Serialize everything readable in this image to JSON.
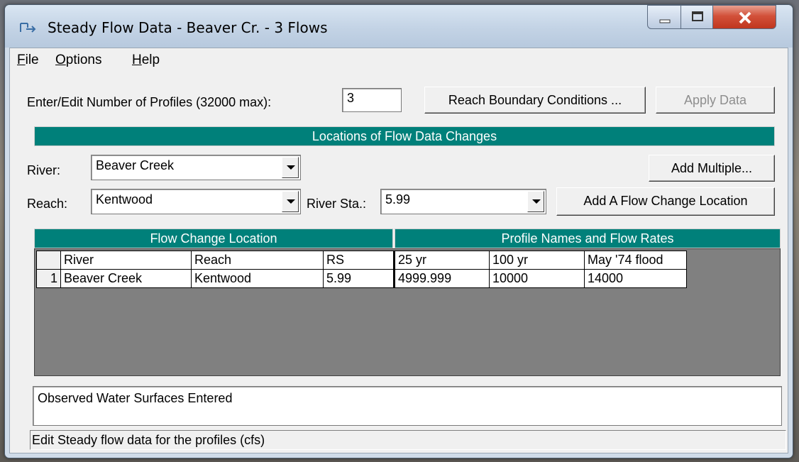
{
  "window": {
    "title": "Steady Flow Data - Beaver Cr. - 3 Flows",
    "controls": {
      "minimize": "–",
      "maximize": "□",
      "close": "x"
    }
  },
  "menu": {
    "file": {
      "accel": "F",
      "rest": "ile"
    },
    "options": {
      "accel": "O",
      "rest": "ptions"
    },
    "help": {
      "accel": "H",
      "rest": "elp"
    }
  },
  "profiles": {
    "label": "Enter/Edit Number of Profiles (32000 max):",
    "value": "3"
  },
  "buttons": {
    "reach_boundary": "Reach Boundary Conditions ...",
    "apply_data": "Apply Data",
    "add_multiple": "Add Multiple...",
    "add_flow_change": "Add A Flow Change Location"
  },
  "locations_header": "Locations of Flow Data Changes",
  "river": {
    "label": "River:",
    "value": "Beaver Creek"
  },
  "reach": {
    "label": "Reach:",
    "value": "Kentwood"
  },
  "river_sta": {
    "label": "River Sta.:",
    "value": "5.99"
  },
  "table": {
    "left_header": "Flow Change Location",
    "right_header": "Profile Names and Flow Rates",
    "columns": [
      "River",
      "Reach",
      "RS",
      "25 yr",
      "100 yr",
      "May '74 flood"
    ],
    "rows": [
      {
        "num": "1",
        "cells": [
          "Beaver Creek",
          "Kentwood",
          "5.99",
          "4999.999",
          "10000",
          "14000"
        ]
      }
    ]
  },
  "notes": "Observed Water Surfaces Entered",
  "status": "Edit Steady flow data for the profiles (cfs)"
}
